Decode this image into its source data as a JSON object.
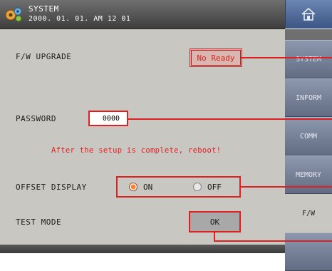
{
  "header": {
    "title": "SYSTEM",
    "datetime": "2000. 01. 01. AM 12 01"
  },
  "settings": {
    "fw_upgrade": {
      "label": "F/W UPGRADE",
      "status": "No Ready"
    },
    "password": {
      "label": "PASSWORD",
      "value": "0000"
    },
    "notice": "After the setup is complete, reboot!",
    "offset_display": {
      "label": "OFFSET DISPLAY",
      "options": [
        "ON",
        "OFF"
      ],
      "selected": "ON"
    },
    "test_mode": {
      "label": "TEST MODE",
      "button": "OK"
    }
  },
  "tabs": [
    {
      "label": "SYSTEM",
      "active": false
    },
    {
      "label": "INFORM",
      "active": false
    },
    {
      "label": "COMM",
      "active": false
    },
    {
      "label": "MEMORY",
      "active": false
    },
    {
      "label": "F/W",
      "active": true
    },
    {
      "label": "",
      "active": false
    }
  ],
  "colors": {
    "panel_bg": "#c9c7c1",
    "highlight_red": "#e02020",
    "tab_blue": "#7a85a0",
    "radio_selected": "#ff7d2a"
  },
  "icons": {
    "header": "gear-icon",
    "home": "home-icon"
  }
}
